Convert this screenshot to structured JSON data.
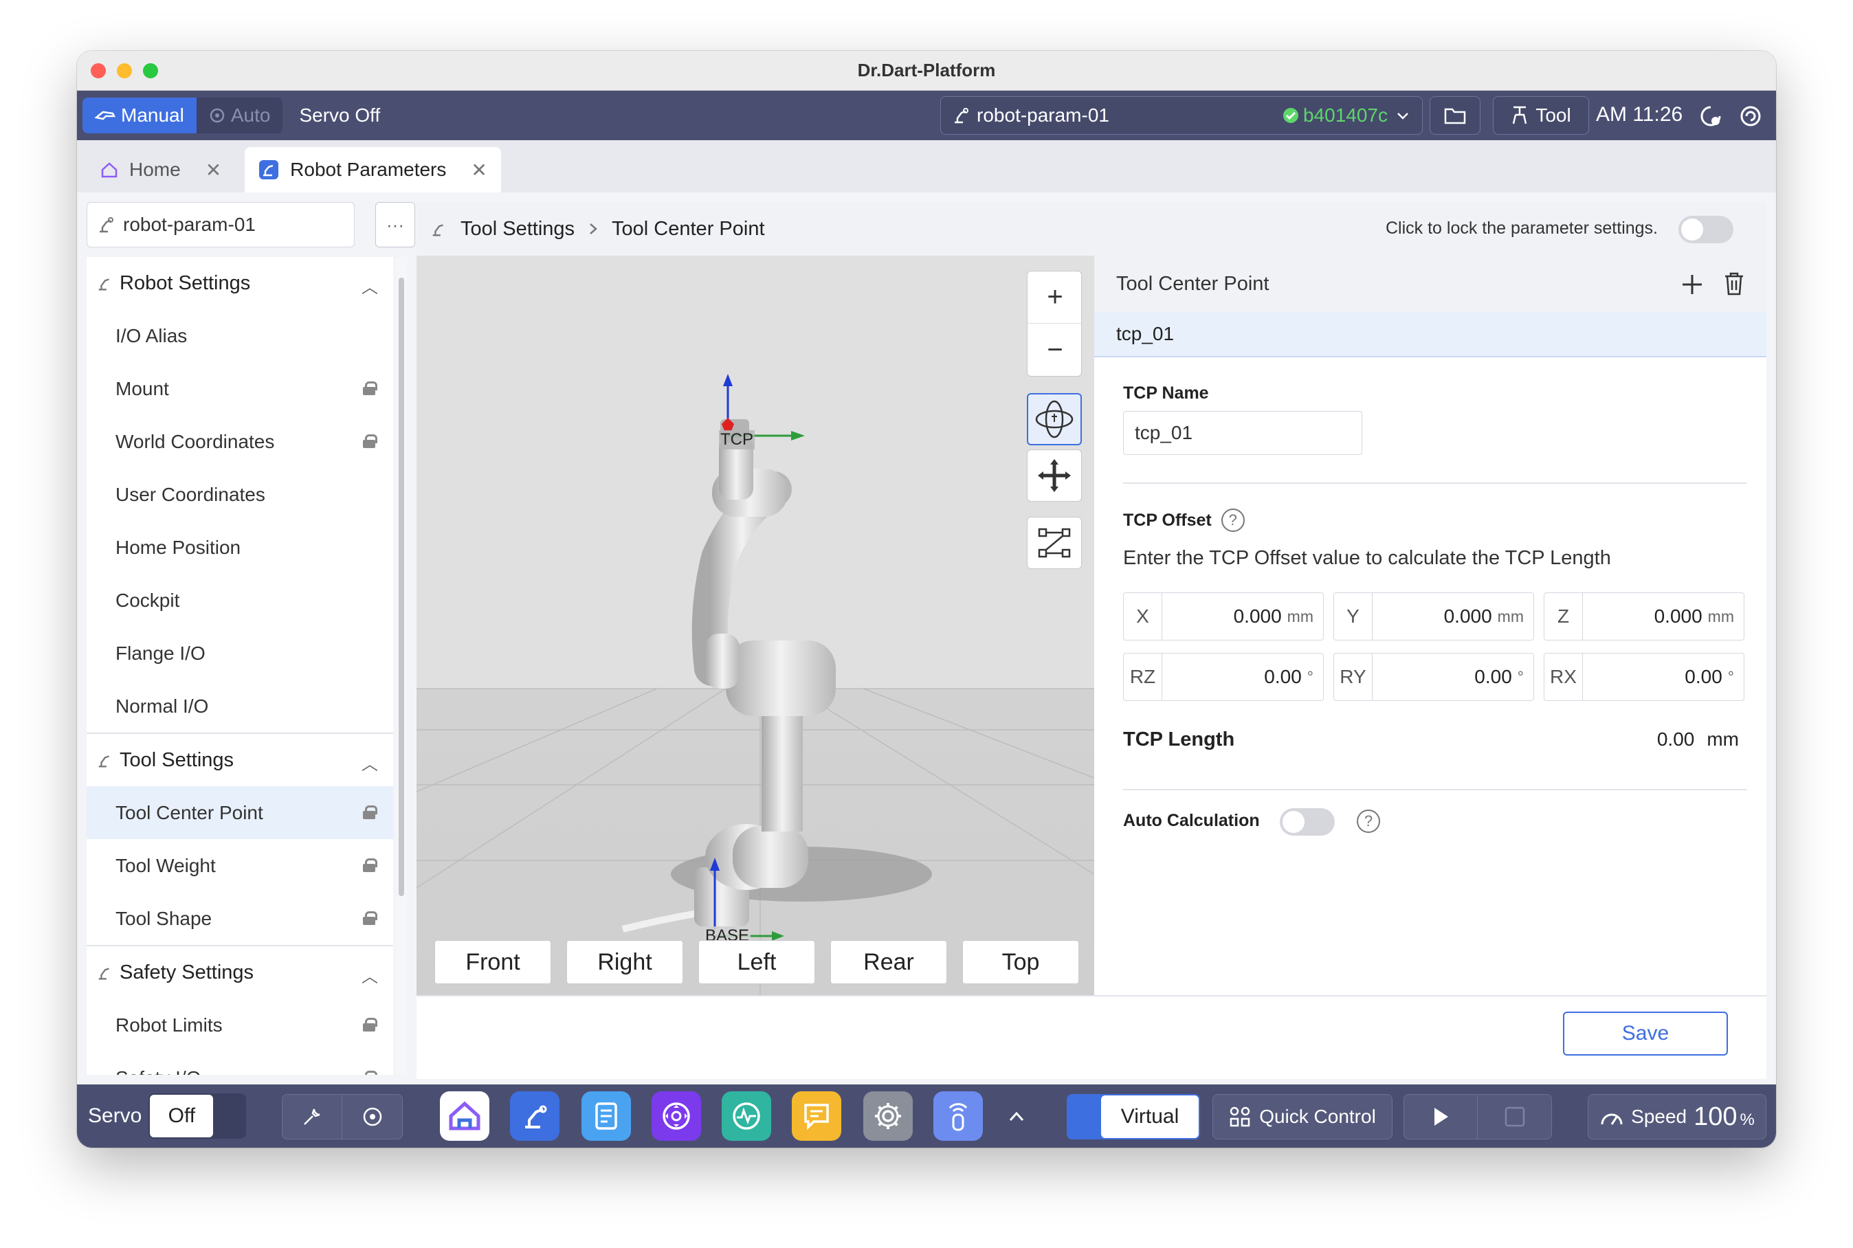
{
  "window": {
    "title": "Dr.Dart-Platform"
  },
  "topbar": {
    "mode_manual": "Manual",
    "mode_auto": "Auto",
    "servo_status": "Servo Off",
    "robot_name": "robot-param-01",
    "commit_hash": "b401407c",
    "tool_label": "Tool",
    "time": "AM 11:26"
  },
  "tabs": [
    {
      "label": "Home"
    },
    {
      "label": "Robot Parameters"
    }
  ],
  "sidebar": {
    "robot_name": "robot-param-01",
    "more": "···",
    "sections": [
      {
        "title": "Robot Settings",
        "items": [
          {
            "label": "I/O Alias"
          },
          {
            "label": "Mount"
          },
          {
            "label": "World Coordinates"
          },
          {
            "label": "User Coordinates"
          },
          {
            "label": "Home Position"
          },
          {
            "label": "Cockpit"
          },
          {
            "label": "Flange I/O"
          },
          {
            "label": "Normal I/O"
          }
        ]
      },
      {
        "title": "Tool Settings",
        "items": [
          {
            "label": "Tool Center Point"
          },
          {
            "label": "Tool Weight"
          },
          {
            "label": "Tool Shape"
          }
        ]
      },
      {
        "title": "Safety Settings",
        "items": [
          {
            "label": "Robot Limits"
          },
          {
            "label": "Safety I/O"
          }
        ]
      }
    ]
  },
  "breadcrumb": {
    "parent": "Tool Settings",
    "current": "Tool Center Point"
  },
  "lock_hint": "Click to lock the parameter settings.",
  "viewport": {
    "zoom_in": "+",
    "zoom_out": "−",
    "tcp_label": "TCP",
    "base_label": "BASE",
    "views": [
      "Front",
      "Right",
      "Left",
      "Rear",
      "Top"
    ]
  },
  "panel": {
    "title": "Tool Center Point",
    "selected_tcp": "tcp_01",
    "tcp_name_label": "TCP Name",
    "tcp_name_value": "tcp_01",
    "offset_label": "TCP Offset",
    "offset_hint": "Enter the TCP Offset value to calculate the TCP Length",
    "offsets": [
      {
        "axis": "X",
        "value": "0.000",
        "unit": "mm"
      },
      {
        "axis": "Y",
        "value": "0.000",
        "unit": "mm"
      },
      {
        "axis": "Z",
        "value": "0.000",
        "unit": "mm"
      },
      {
        "axis": "RZ",
        "value": "0.00",
        "unit": "°"
      },
      {
        "axis": "RY",
        "value": "0.00",
        "unit": "°"
      },
      {
        "axis": "RX",
        "value": "0.00",
        "unit": "°"
      }
    ],
    "length_label": "TCP Length",
    "length_value": "0.00",
    "length_unit": "mm",
    "auto_calc_label": "Auto Calculation",
    "help": "?",
    "save": "Save"
  },
  "dock": {
    "servo_label": "Servo",
    "servo_value": "Off",
    "virtual": "Virtual",
    "quick_control": "Quick Control",
    "speed_label": "Speed",
    "speed_value": "100",
    "speed_unit": "%"
  },
  "colors": {
    "accent": "#3e6fe0",
    "topbar": "#4a4f72",
    "ok": "#5ed66b"
  }
}
